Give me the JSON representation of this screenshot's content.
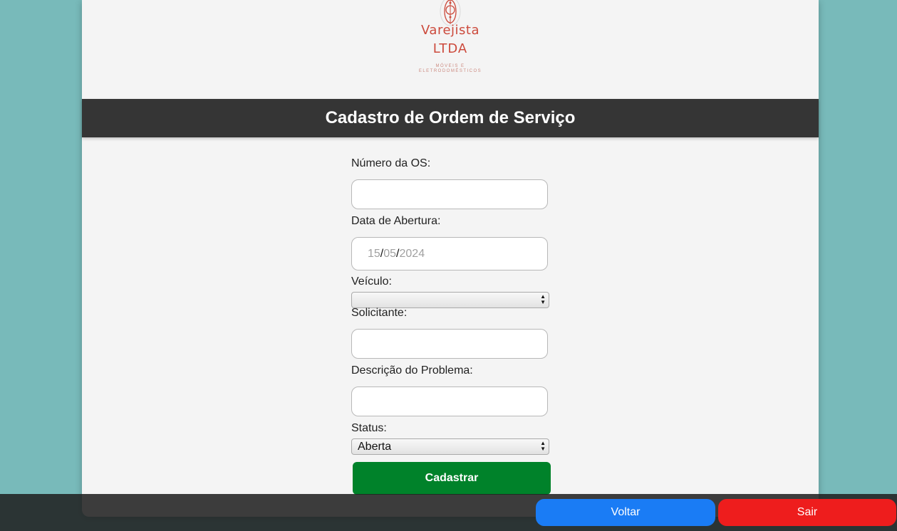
{
  "brand": {
    "name_line1": "Varejista",
    "name_line2": "LTDA",
    "tagline_line1": "MÓVEIS E",
    "tagline_line2": "ELETRODOMÉSTICOS"
  },
  "header": {
    "title": "Cadastro de Ordem de Serviço"
  },
  "form": {
    "numero_os": {
      "label": "Número da OS:",
      "value": ""
    },
    "data_abertura": {
      "label": "Data de Abertura:",
      "day": "15",
      "month": "05",
      "year": "2024",
      "sep": "/"
    },
    "veiculo": {
      "label": "Veículo:",
      "value": ""
    },
    "solicitante": {
      "label": "Solicitante:",
      "value": ""
    },
    "descricao": {
      "label": "Descrição do Problema:",
      "value": ""
    },
    "status": {
      "label": "Status:",
      "value": "Aberta"
    },
    "submit_label": "Cadastrar"
  },
  "footer": {
    "back_label": "Voltar",
    "exit_label": "Sair"
  },
  "colors": {
    "background": "#78baba",
    "header": "#353535",
    "submit": "#00822a",
    "back": "#1a7cf5",
    "exit": "#ee1d1d",
    "brand": "#cc4a3c"
  }
}
